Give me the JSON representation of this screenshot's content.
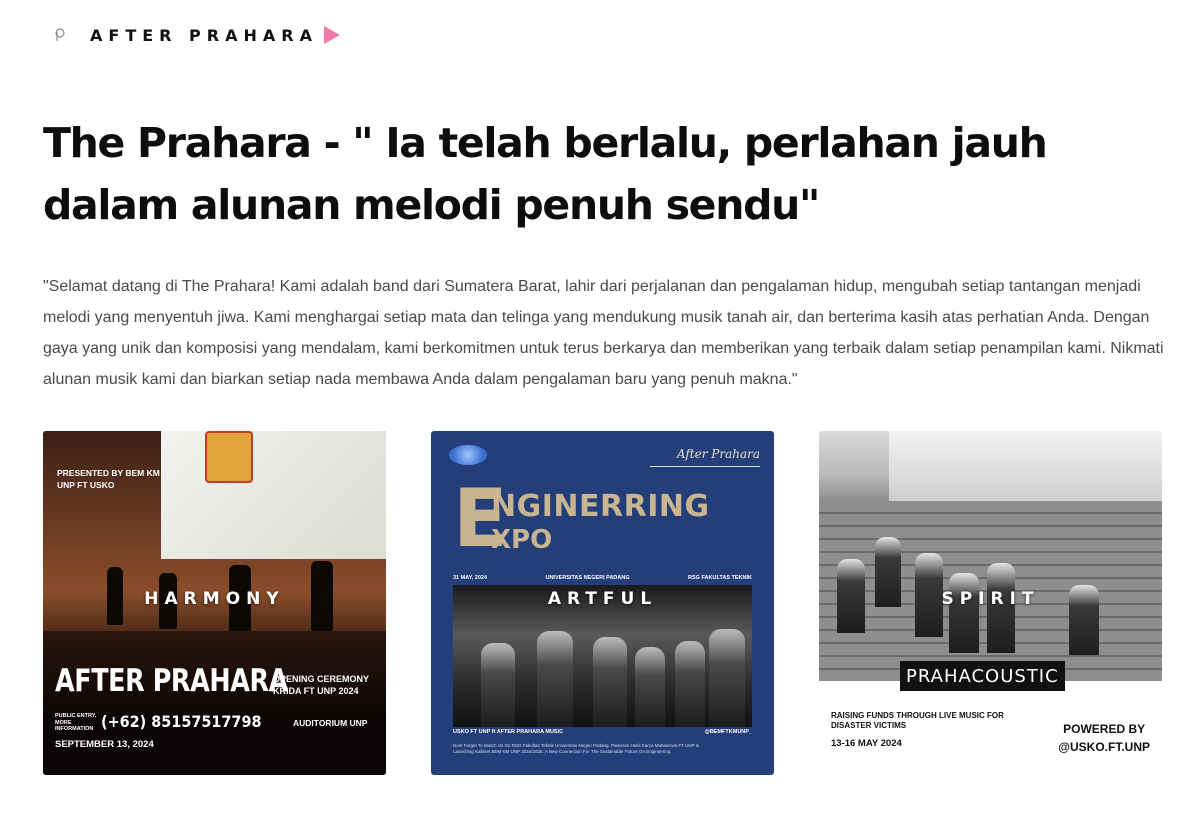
{
  "header": {
    "brand": "AFTER PRAHARA",
    "logo_icon": "p-logo-icon",
    "play_icon": "play-arrow-icon",
    "accent_color": "#f07aa8"
  },
  "main": {
    "title": "The Prahara - \" Ia telah berlalu, perlahan jauh dalam alunan melodi penuh sendu\"",
    "intro": "\"Selamat datang di The Prahara! Kami adalah band dari Sumatera Barat, lahir dari perjalanan dan pengalaman hidup, mengubah setiap tantangan menjadi melodi yang menyentuh jiwa. Kami menghargai setiap mata dan telinga yang mendukung musik tanah air, dan berterima kasih atas perhatian Anda. Dengan gaya yang unik dan komposisi yang mendalam, kami berkomitmen untuk terus berkarya dan memberikan yang terbaik dalam setiap penampilan kami. Nikmati alunan musik kami dan biarkan setiap nada membawa Anda dalam pengalaman baru yang penuh makna.\""
  },
  "cards": [
    {
      "label": "HARMONY",
      "presented": "PRESENTED BY BEM KM UNP FT USKO",
      "band": "AFTER PRAHARA",
      "event": "OPENING CEREMONY KRIDA FT UNP 2024",
      "public": "PUBLIC ENTRY, MORE INFORMATION",
      "phone": "(+62) 85157517798",
      "venue": "AUDITORIUM UNP",
      "date": "SEPTEMBER 13, 2024"
    },
    {
      "label": "ARTFUL",
      "script": "After Prahara",
      "big_letter": "E",
      "line1": "NGINERRING",
      "line2": "XPO",
      "meta_left": "31 MAY, 2024",
      "meta_mid": "UNIVERSITAS NEGERI PADANG",
      "meta_right": "RSG FAKULTAS TEKNIK",
      "photo_left": "USKO FT UNP ft AFTER PRAHARA MUSIC",
      "photo_right": "@BEMFTKMUNP_",
      "footer": "Dont Forget To Watch Us On RSG Fakultas Teknik Universitas Negeri Padang. Pameran Hasil Karya Mahasiswa FT UNP & Launching Kabinet BEM KM UNP 2024/2025. A New Connection For The Sustainable Future On Engineering."
    },
    {
      "label": "SPIRIT",
      "tag": "PRAHACOUSTIC",
      "raise": "RAISING FUNDS THROUGH LIVE MUSIC FOR DISASTER VICTIMS",
      "date": "13-16 MAY 2024",
      "powered": "POWERED BY",
      "handle": "@USKO.FT.UNP"
    }
  ]
}
